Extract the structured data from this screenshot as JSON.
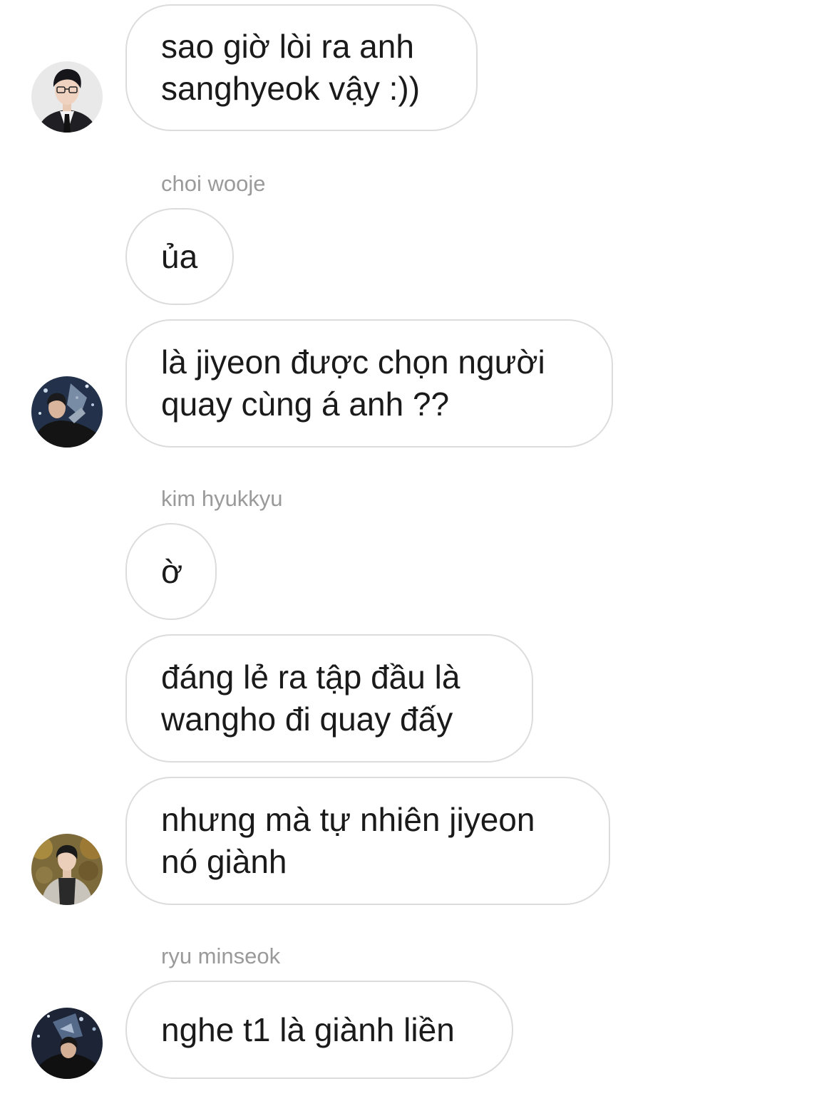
{
  "messages": [
    {
      "text": "sao giờ lòi ra anh\nsanghyeok vậy :))"
    },
    {
      "text": "ủa"
    },
    {
      "text": "là jiyeon được chọn người\nquay cùng á anh ??"
    },
    {
      "text": "ờ"
    },
    {
      "text": "đáng lẻ ra tập đầu là\nwangho đi quay đấy"
    },
    {
      "text": "nhưng mà tự nhiên jiyeon\nnó giành"
    },
    {
      "text": "nghe t1 là giành liền"
    }
  ],
  "senders": {
    "s1": "choi wooje",
    "s2": "kim hyukkyu",
    "s3": "ryu minseok"
  },
  "avatars": [
    {
      "icon": "profile-photo-suit-glasses"
    },
    {
      "icon": "profile-photo-trophy-confetti"
    },
    {
      "icon": "profile-photo-autumn-jacket"
    },
    {
      "icon": "profile-photo-trophy-dark"
    }
  ],
  "colors": {
    "bubble_border": "#dcdcdc",
    "text": "#1a1a1a",
    "sender_name": "#9a9a9a",
    "background": "#ffffff"
  }
}
